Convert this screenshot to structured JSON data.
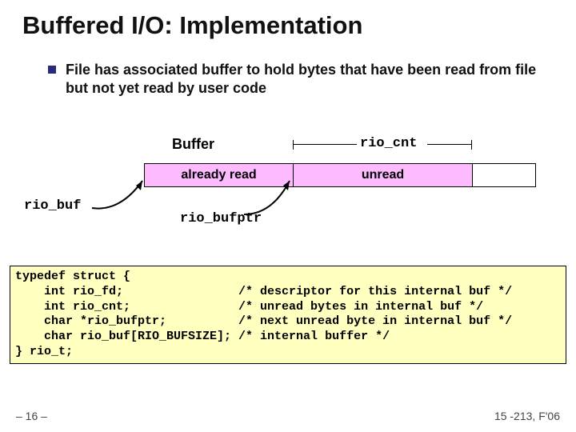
{
  "title": "Buffered I/O: Implementation",
  "bullet": "File has associated buffer to hold bytes that have been read from file but not yet read by user code",
  "labels": {
    "buffer": "Buffer",
    "rio_cnt": "rio_cnt",
    "already_read": "already read",
    "unread": "unread",
    "rio_buf": "rio_buf",
    "rio_bufptr": "rio_bufptr"
  },
  "code": "typedef struct {\n    int rio_fd;                /* descriptor for this internal buf */\n    int rio_cnt;               /* unread bytes in internal buf */\n    char *rio_bufptr;          /* next unread byte in internal buf */\n    char rio_buf[RIO_BUFSIZE]; /* internal buffer */\n} rio_t;",
  "footer": {
    "left": "– 16 –",
    "right": "15 -213, F'06"
  }
}
